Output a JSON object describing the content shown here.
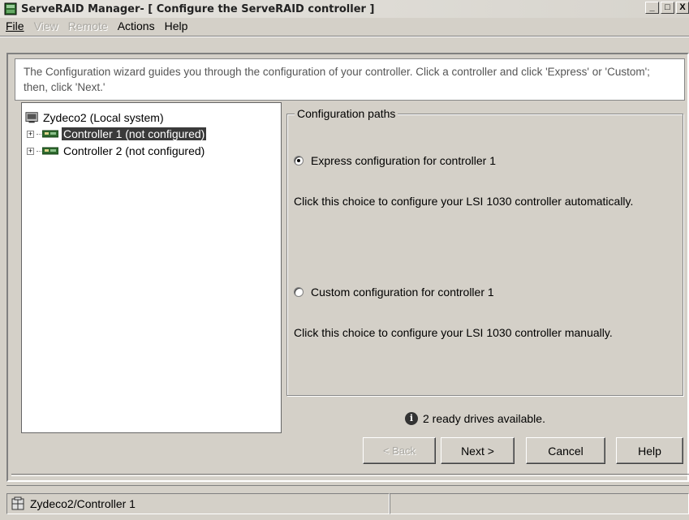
{
  "window": {
    "title": "ServeRAID Manager- [ Configure the ServeRAID controller ]",
    "minimize": "_",
    "maximize": "□",
    "close": "X"
  },
  "menu": {
    "file": "File",
    "view": "View",
    "remote": "Remote",
    "actions": "Actions",
    "help": "Help"
  },
  "wizard": {
    "instructions": "The Configuration wizard guides you through the configuration of your controller. Click a controller and click 'Express' or 'Custom'; then, click 'Next.'"
  },
  "tree": {
    "root": "Zydeco2 (Local system)",
    "items": [
      {
        "label": "Controller 1 (not configured)",
        "selected": true
      },
      {
        "label": "Controller 2 (not configured)",
        "selected": false
      }
    ]
  },
  "config": {
    "group_title": "Configuration paths",
    "express_label": "Express configuration for controller 1",
    "express_checked": true,
    "express_desc": "Click this choice to configure your LSI 1030 controller automatically.",
    "custom_label": "Custom configuration for controller 1",
    "custom_checked": false,
    "custom_desc": "Click this choice to configure your LSI 1030 controller manually."
  },
  "status_info": "2 ready drives available.",
  "buttons": {
    "back": "< Back",
    "next": "Next >",
    "cancel": "Cancel",
    "help": "Help"
  },
  "statusbar": {
    "path": "Zydeco2/Controller 1"
  }
}
